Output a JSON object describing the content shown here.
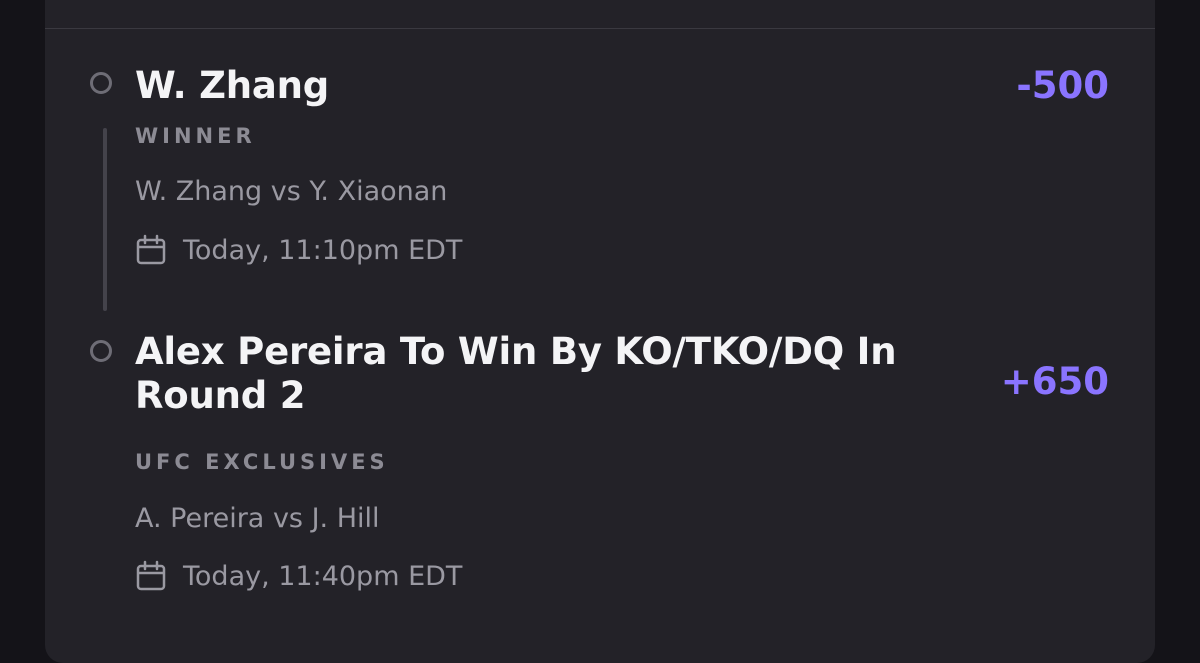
{
  "colors": {
    "background": "#141318",
    "card": "#232228",
    "odds_accent": "#8a74ff",
    "primary_text": "#f4f4f6",
    "secondary_text": "#9a99a2"
  },
  "legs": [
    {
      "selection": "W. Zhang",
      "odds": "-500",
      "market": "WINNER",
      "event": "W. Zhang vs Y. Xiaonan",
      "datetime": "Today, 11:10pm EDT",
      "icon": "calendar-icon"
    },
    {
      "selection": "Alex Pereira To Win By KO/TKO/DQ In Round 2",
      "odds": "+650",
      "market": "UFC EXCLUSIVES",
      "event": "A. Pereira vs J. Hill",
      "datetime": "Today, 11:40pm EDT",
      "icon": "calendar-icon"
    }
  ]
}
